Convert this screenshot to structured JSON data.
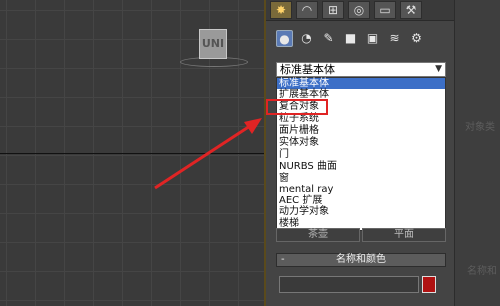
{
  "viewport": {
    "object_label": "UNI"
  },
  "command_panel": {
    "tabs": [
      {
        "icon": "create-icon",
        "glyph": "✸"
      },
      {
        "icon": "modify-icon",
        "glyph": "◠"
      },
      {
        "icon": "hierarchy-icon",
        "glyph": "⊞"
      },
      {
        "icon": "motion-icon",
        "glyph": "◎"
      },
      {
        "icon": "display-icon",
        "glyph": "▭"
      },
      {
        "icon": "utilities-icon",
        "glyph": "⚒"
      }
    ],
    "subcategories": [
      {
        "icon": "geometry-icon",
        "glyph": "●"
      },
      {
        "icon": "shapes-icon",
        "glyph": "◔"
      },
      {
        "icon": "lights-icon",
        "glyph": "✎"
      },
      {
        "icon": "cameras-icon",
        "glyph": "■"
      },
      {
        "icon": "helpers-icon",
        "glyph": "▣"
      },
      {
        "icon": "spacewarps-icon",
        "glyph": "≋"
      },
      {
        "icon": "systems-icon",
        "glyph": "⚙"
      }
    ],
    "category_select": {
      "value": "标准基本体"
    },
    "dropdown_options": [
      "标准基本体",
      "扩展基本体",
      "复合对象",
      "粒子系统",
      "面片栅格",
      "实体对象",
      "门",
      "NURBS 曲面",
      "窗",
      "mental ray",
      "AEC 扩展",
      "动力学对象",
      "楼梯"
    ],
    "selected_option_index": 0,
    "highlighted_option": "复合对象",
    "buttons": {
      "left": "茶壶",
      "right": "平面"
    },
    "rollout": {
      "toggle": "-",
      "title": "名称和颜色"
    },
    "name_value": "",
    "object_color": "#b01212"
  },
  "side_panel": {
    "label_top": "对象类",
    "label_bottom": "名称和"
  },
  "annotation": {
    "arrow_color": "#e02424",
    "highlight_color": "#e02424"
  }
}
